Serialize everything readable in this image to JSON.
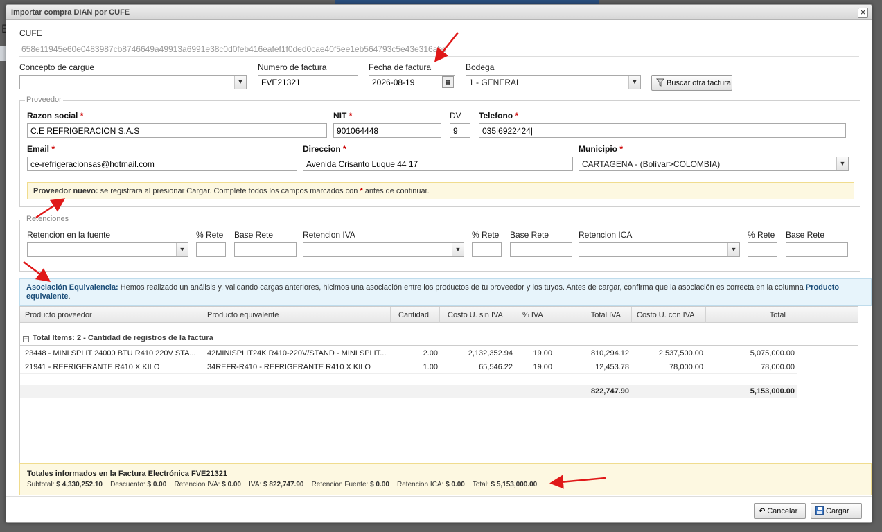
{
  "dialog": {
    "title": "Importar compra DIAN por CUFE",
    "close": "×"
  },
  "cufe": {
    "label": "CUFE",
    "value": "658e11945e60e0483987cb8746649a49913a6991e38c0d0feb416eafef1f0ded0cae40f5ee1eb564793c5e43e316abd"
  },
  "header": {
    "concepto_label": "Concepto de cargue",
    "concepto_value": "",
    "numero_label": "Numero de factura",
    "numero_value": "FVE21321",
    "fecha_label": "Fecha de factura",
    "fecha_value": "2026-08-19",
    "bodega_label": "Bodega",
    "bodega_value": "1 - GENERAL",
    "buscar_label": "Buscar otra factura"
  },
  "proveedor": {
    "legend": "Proveedor",
    "razon_label": "Razon social",
    "razon_value": "C.E REFRIGERACION S.A.S",
    "nit_label": "NIT",
    "nit_value": "901064448",
    "dv_label": "DV",
    "dv_value": "9",
    "tel_label": "Telefono",
    "tel_value": "035|6922424|",
    "email_label": "Email",
    "email_value": "ce-refrigeracionsas@hotmail.com",
    "dir_label": "Direccion",
    "dir_value": "Avenida Crisanto Luque  44 17",
    "mun_label": "Municipio",
    "mun_value": "CARTAGENA - (Bolívar>COLOMBIA)",
    "required_mark": "*",
    "alert_bold": "Proveedor nuevo:",
    "alert_text": " se registrara al presionar Cargar. Complete todos los campos marcados con ",
    "alert_star": "*",
    "alert_end": " antes de continuar."
  },
  "retenciones": {
    "legend": "Retenciones",
    "fuente_label": "Retencion en la fuente",
    "iva_label": "Retencion IVA",
    "ica_label": "Retencion ICA",
    "pct_label": "% Rete",
    "base_label": "Base Rete"
  },
  "asociacion": {
    "bold": "Asociación Equivalencia:",
    "text": " Hemos realizado un análisis y, validando cargas anteriores, hicimos una asociación entre los productos de tu proveedor y los tuyos. Antes de cargar, confirma que la asociación es correcta en la columna ",
    "bold2": "Producto equivalente",
    "end": "."
  },
  "grid": {
    "columns": [
      "Producto proveedor",
      "Producto equivalente",
      "Cantidad",
      "Costo U. sin IVA",
      "% IVA",
      "Total IVA",
      "Costo U. con IVA",
      "Total"
    ],
    "group": "Total Items: 2 - Cantidad de registros de la factura",
    "group_toggle": "−",
    "rows": [
      [
        "23448 - MINI SPLIT 24000 BTU R410 220V STA...",
        "42MINISPLIT24K R410-220V/STAND - MINI SPLIT...",
        "2.00",
        "2,132,352.94",
        "19.00",
        "810,294.12",
        "2,537,500.00",
        "5,075,000.00"
      ],
      [
        "21941 - REFRIGERANTE R410 X KILO",
        "34REFR-R410 - REFRIGERANTE R410 X KILO",
        "1.00",
        "65,546.22",
        "19.00",
        "12,453.78",
        "78,000.00",
        "78,000.00"
      ]
    ],
    "sum_iva": "822,747.90",
    "sum_total": "5,153,000.00"
  },
  "totales": {
    "title": "Totales informados en la Factura Electrónica FVE21321",
    "subtotal_label": "Subtotal:",
    "subtotal": "$ 4,330,252.10",
    "descuento_label": "Descuento:",
    "descuento": "$ 0.00",
    "rete_iva_label": "Retencion IVA:",
    "rete_iva": "$ 0.00",
    "iva_label": "IVA:",
    "iva": "$ 822,747.90",
    "rete_fuente_label": "Retencion Fuente:",
    "rete_fuente": "$ 0.00",
    "rete_ica_label": "Retencion ICA:",
    "rete_ica": "$ 0.00",
    "total_label": "Total:",
    "total": "$ 5,153,000.00"
  },
  "footer": {
    "cancel": "Cancelar",
    "load": "Cargar"
  },
  "background": {
    "e_letter": "E"
  },
  "colors": {
    "arrow": "#e01818",
    "required": "#cc0000",
    "alert_bg": "#fdf8e1",
    "info_bg": "#e7f4fb"
  }
}
